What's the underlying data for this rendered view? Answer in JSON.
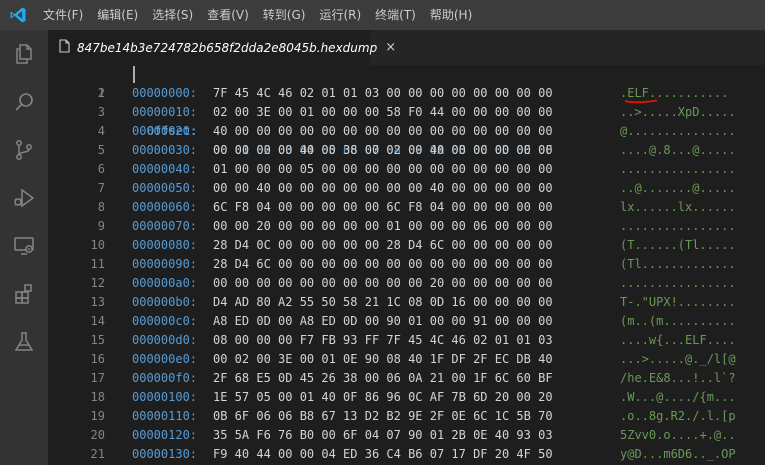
{
  "menu": [
    "文件(F)",
    "编辑(E)",
    "选择(S)",
    "查看(V)",
    "转到(G)",
    "运行(R)",
    "终端(T)",
    "帮助(H)"
  ],
  "tab": {
    "title": "847be14b3e724782b658f2dda2e8045b.hexdump",
    "close": "×"
  },
  "icons": {
    "logo": "vscode-logo-icon",
    "activity": [
      "explorer-icon",
      "search-icon",
      "source-control-icon",
      "run-debug-icon",
      "remote-explorer-icon",
      "extensions-icon",
      "testing-icon"
    ]
  },
  "colors": {
    "offset": "#569cd6",
    "hex": "#d4d4d4",
    "ascii": "#6a9955",
    "line_number": "#858585",
    "annotation": "#e51400"
  },
  "editor": {
    "header": {
      "line": "1",
      "label": "Offset:",
      "columns": "00 01 02 03 04 05 06 07 08 09 0A 0B 0C 0D 0E 0F"
    },
    "rows": [
      {
        "line": "2",
        "offset": "00000000:",
        "hex": "7F 45 4C 46 02 01 01 03 00 00 00 00 00 00 00 00",
        "ascii": ".ELF..........."
      },
      {
        "line": "3",
        "offset": "00000010:",
        "hex": "02 00 3E 00 01 00 00 00 58 F0 44 00 00 00 00 00",
        "ascii": "..>.....XpD....."
      },
      {
        "line": "4",
        "offset": "00000020:",
        "hex": "40 00 00 00 00 00 00 00 00 00 00 00 00 00 00 00",
        "ascii": "@..............."
      },
      {
        "line": "5",
        "offset": "00000030:",
        "hex": "00 00 00 00 40 00 38 00 02 00 40 00 00 00 00 00",
        "ascii": "....@.8...@....."
      },
      {
        "line": "6",
        "offset": "00000040:",
        "hex": "01 00 00 00 05 00 00 00 00 00 00 00 00 00 00 00",
        "ascii": "................"
      },
      {
        "line": "7",
        "offset": "00000050:",
        "hex": "00 00 40 00 00 00 00 00 00 00 40 00 00 00 00 00",
        "ascii": "..@.......@....."
      },
      {
        "line": "8",
        "offset": "00000060:",
        "hex": "6C F8 04 00 00 00 00 00 6C F8 04 00 00 00 00 00",
        "ascii": "lx......lx......"
      },
      {
        "line": "9",
        "offset": "00000070:",
        "hex": "00 00 20 00 00 00 00 00 01 00 00 00 06 00 00 00",
        "ascii": "................"
      },
      {
        "line": "10",
        "offset": "00000080:",
        "hex": "28 D4 0C 00 00 00 00 00 28 D4 6C 00 00 00 00 00",
        "ascii": "(T......(Tl....."
      },
      {
        "line": "11",
        "offset": "00000090:",
        "hex": "28 D4 6C 00 00 00 00 00 00 00 00 00 00 00 00 00",
        "ascii": "(Tl............."
      },
      {
        "line": "12",
        "offset": "000000a0:",
        "hex": "00 00 00 00 00 00 00 00 00 00 20 00 00 00 00 00",
        "ascii": "................"
      },
      {
        "line": "13",
        "offset": "000000b0:",
        "hex": "D4 AD 80 A2 55 50 58 21 1C 08 0D 16 00 00 00 00",
        "ascii": "T-.\"UPX!........"
      },
      {
        "line": "14",
        "offset": "000000c0:",
        "hex": "A8 ED 0D 00 A8 ED 0D 00 90 01 00 00 91 00 00 00",
        "ascii": "(m..(m.........."
      },
      {
        "line": "15",
        "offset": "000000d0:",
        "hex": "08 00 00 00 F7 FB 93 FF 7F 45 4C 46 02 01 01 03",
        "ascii": "....w{...ELF...."
      },
      {
        "line": "16",
        "offset": "000000e0:",
        "hex": "00 02 00 3E 00 01 0E 90 08 40 1F DF 2F EC DB 40",
        "ascii": "...>.....@._/l[@"
      },
      {
        "line": "17",
        "offset": "000000f0:",
        "hex": "2F 68 E5 0D 45 26 38 00 06 0A 21 00 1F 6C 60 BF",
        "ascii": "/he.E&8...!..l`?"
      },
      {
        "line": "18",
        "offset": "00000100:",
        "hex": "1E 57 05 00 01 40 0F 86 96 0C AF 7B 6D 20 00 20",
        "ascii": ".W...@..../{m..."
      },
      {
        "line": "19",
        "offset": "00000110:",
        "hex": "0B 6F 06 06 B8 67 13 D2 B2 9E 2F 0E 6C 1C 5B 70",
        "ascii": ".o..8g.R2./.l.[p"
      },
      {
        "line": "20",
        "offset": "00000120:",
        "hex": "35 5A F6 76 B0 00 6F 04 07 90 01 2B 0E 40 93 03",
        "ascii": "5Zvv0.o....+.@.."
      },
      {
        "line": "21",
        "offset": "00000130:",
        "hex": "F9 40 44 00 00 04 ED 36 C4 B6 07 17 DF 20 4F 50",
        "ascii": "y@D...m6D6.._.OP"
      }
    ]
  }
}
